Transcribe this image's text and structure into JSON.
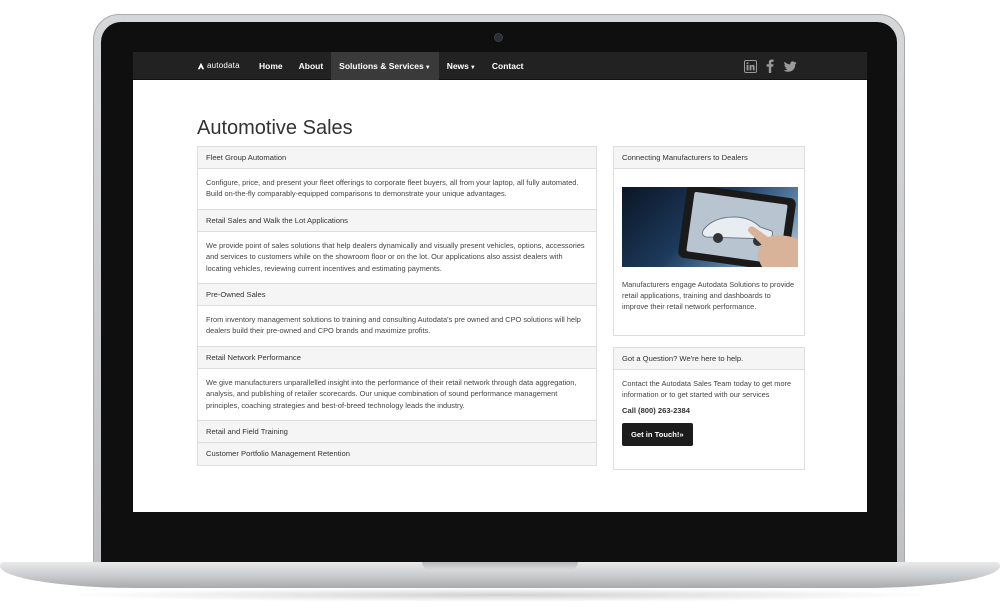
{
  "navbar": {
    "logo_text": "autodata",
    "items": [
      {
        "label": "Home"
      },
      {
        "label": "About"
      },
      {
        "label": "Solutions & Services"
      },
      {
        "label": "News"
      },
      {
        "label": "Contact"
      }
    ],
    "active_item": "Solutions & Services",
    "social_icons": [
      "linkedin-icon",
      "facebook-icon",
      "twitter-icon"
    ]
  },
  "page": {
    "title": "Automotive Sales"
  },
  "accordion": [
    {
      "heading": "Fleet Group Automation",
      "body": "Configure, price, and present your fleet offerings to corporate fleet buyers, all from your laptop, all fully automated. Build on-the-fly comparably-equipped comparisons to demonstrate your unique advantages."
    },
    {
      "heading": "Retail Sales and Walk the Lot Applications",
      "body": "We provide point of sales solutions that help dealers dynamically and visually present vehicles, options, accessories and services to customers while on the showroom floor or on the lot. Our applications also assist dealers with locating vehicles, reviewing current incentives and estimating payments."
    },
    {
      "heading": "Pre-Owned Sales",
      "body": "From inventory management solutions to training and consulting Autodata's pre owned and CPO solutions will help dealers build their pre-owned and CPO brands and maximize profits."
    },
    {
      "heading": "Retail Network Performance",
      "body": "We give manufacturers unparallelled insight into the performance of their retail network through data aggregation, analysis, and publishing of retailer scorecards. Our unique combination of sound performance management principles, coaching strategies and best-of-breed technology leads the industry."
    },
    {
      "heading": "Retail and Field Training"
    },
    {
      "heading": "Customer Portfolio Management Retention"
    }
  ],
  "sidebar": {
    "manufacturers_panel": {
      "heading": "Connecting Manufacturers to Dealers",
      "body": "Manufacturers engage Autodata Solutions to provide retail applications, training and dashboards to improve their retail network performance."
    },
    "question_panel": {
      "heading": "Got a Question? We're here to help.",
      "body": "Contact the Autodata Sales Team today to get more information or to get started with our services",
      "phone": "Call (800) 263-2384",
      "cta_label": "Get in Touch!»"
    }
  },
  "colors": {
    "navbar_bg": "#222222",
    "panel_header_bg": "#f5f5f5",
    "cta_bg": "#1c1c1c"
  }
}
